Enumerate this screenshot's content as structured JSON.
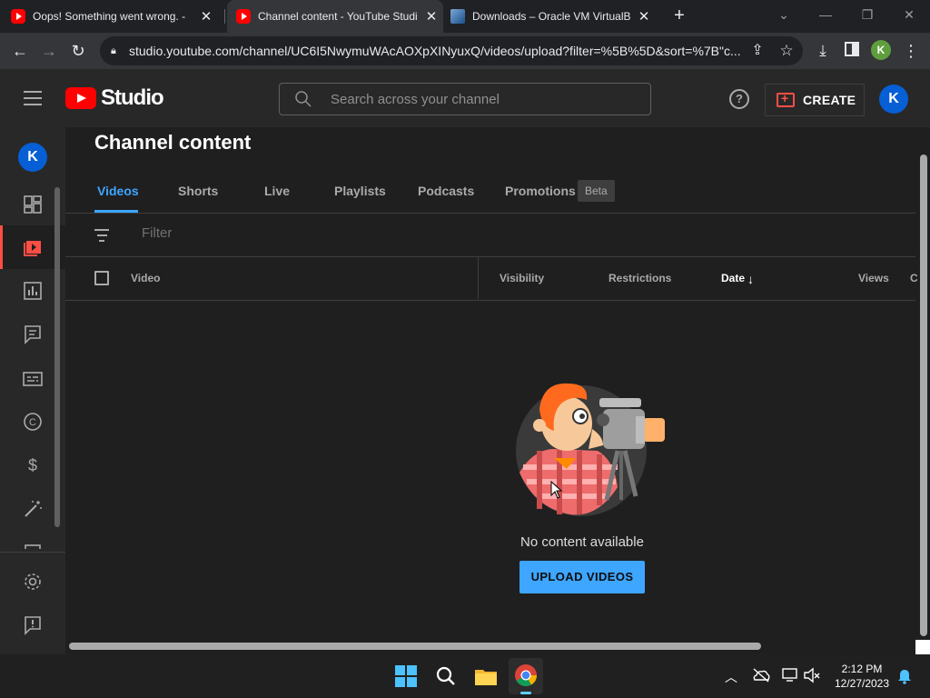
{
  "browser": {
    "tabs": [
      {
        "title": "Oops! Something went wrong. -",
        "favicon": "youtube-icon",
        "active": false
      },
      {
        "title": "Channel content - YouTube Studio",
        "favicon": "youtube-icon",
        "active": true
      },
      {
        "title": "Downloads – Oracle VM VirtualBox",
        "favicon": "virtualbox-icon",
        "active": false
      }
    ],
    "new_tab": "+",
    "url": "studio.youtube.com/channel/UC6I5NwymuWAcAOXpXINyuxQ/videos/upload?filter=%5B%5D&sort=%7B\"c...",
    "profile_initial": "K"
  },
  "studio": {
    "logo_text": "Studio",
    "search_placeholder": "Search across your channel",
    "help_icon": "?",
    "create_label": "CREATE",
    "account_initial": "K",
    "accent": "#3ea6ff",
    "brand_red": "#ff0000"
  },
  "rail": {
    "avatar_initial": "K",
    "items": [
      "dashboard-icon",
      "content-icon",
      "analytics-icon",
      "comments-icon",
      "subtitles-icon",
      "copyright-icon",
      "earn-icon",
      "customization-icon",
      "audio-library-icon",
      "settings-icon",
      "feedback-icon"
    ]
  },
  "content": {
    "title": "Channel content",
    "tabs": [
      "Videos",
      "Shorts",
      "Live",
      "Playlists",
      "Podcasts",
      "Promotions"
    ],
    "active_tab": "Videos",
    "beta_badge": "Beta",
    "filter_placeholder": "Filter",
    "columns": {
      "video": "Video",
      "visibility": "Visibility",
      "restrictions": "Restrictions",
      "date": "Date",
      "views": "Views",
      "comments": "C"
    },
    "sort_arrow": "↓",
    "empty_message": "No content available",
    "upload_button": "UPLOAD VIDEOS"
  },
  "taskbar": {
    "apps": [
      "start-icon",
      "search-icon",
      "file-explorer-icon",
      "chrome-icon"
    ],
    "tray": [
      "chevron-up-icon",
      "onedrive-icon",
      "network-icon",
      "volume-muted-icon",
      "notification-bell-icon"
    ],
    "time": "2:12 PM",
    "date": "12/27/2023"
  }
}
